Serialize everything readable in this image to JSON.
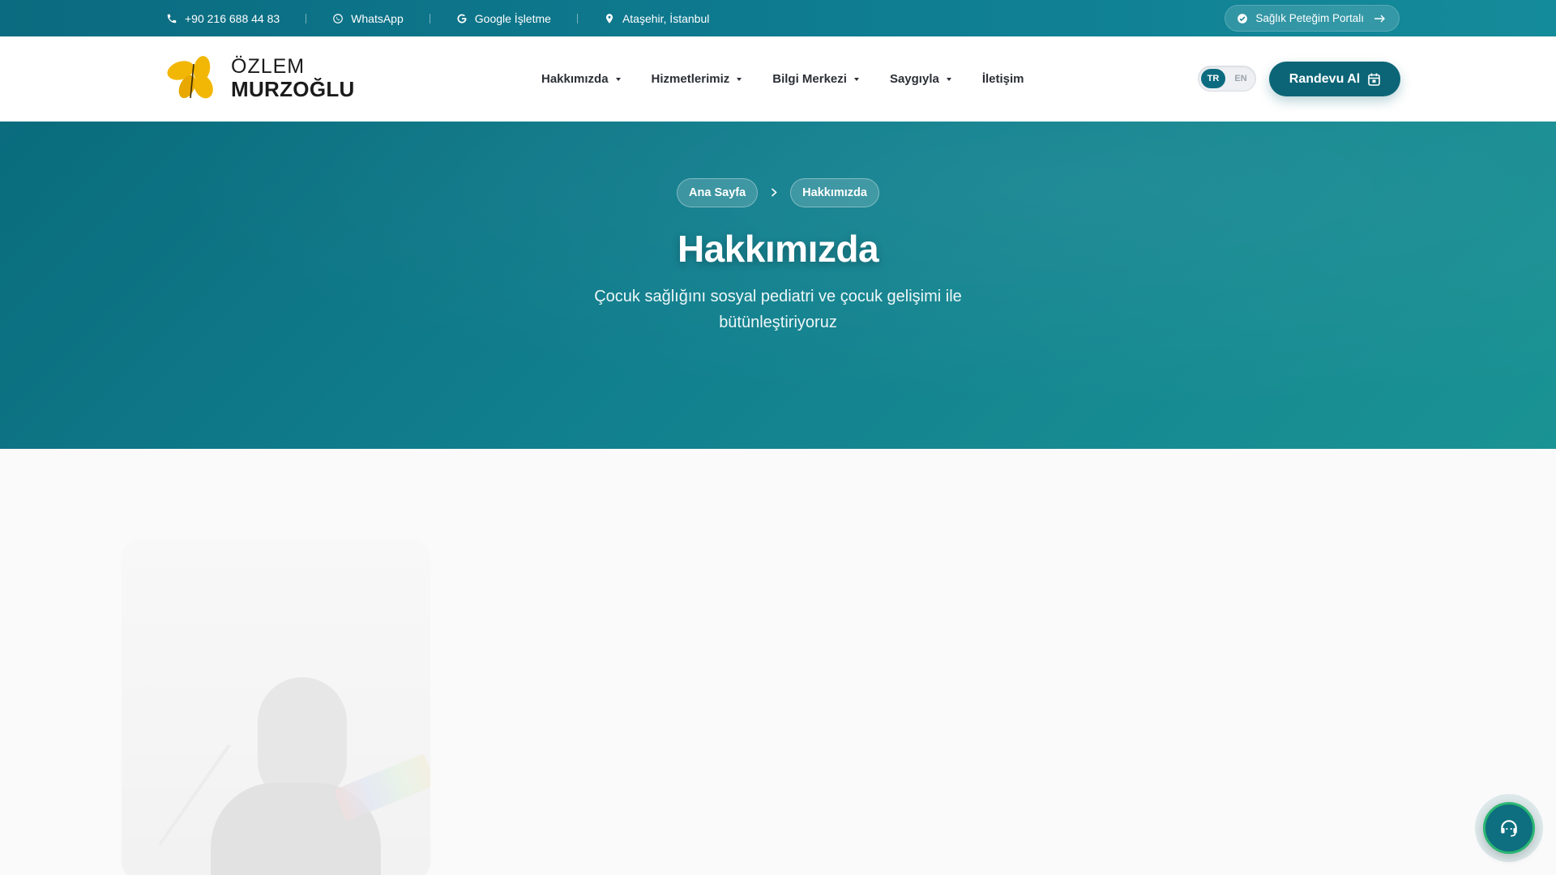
{
  "topbar": {
    "phone": "+90 216 688 44 83",
    "whatsapp": "WhatsApp",
    "google": "Google İşletme",
    "location": "Ataşehir, İstanbul",
    "portal": "Sağlık Peteğim Portalı"
  },
  "header": {
    "logo_line1": "ÖZLEM",
    "logo_line2": "MURZOĞLU",
    "nav": [
      {
        "label": "Hakkımızda",
        "dropdown": true
      },
      {
        "label": "Hizmetlerimiz",
        "dropdown": true
      },
      {
        "label": "Bilgi Merkezi",
        "dropdown": true
      },
      {
        "label": "Saygıyla",
        "dropdown": true
      },
      {
        "label": "İletişim",
        "dropdown": false
      }
    ],
    "lang": {
      "active": "TR",
      "inactive": "EN"
    },
    "cta": "Randevu Al"
  },
  "hero": {
    "breadcrumb": [
      "Ana Sayfa",
      "Hakkımızda"
    ],
    "title": "Hakkımızda",
    "subtitle": "Çocuk sağlığını sosyal pediatri ve çocuk gelişimi ile bütünleştiriyoruz"
  },
  "colors": {
    "brand_teal": "#0b6576",
    "hero_start": "#0a6c7d",
    "hero_end": "#1a9394",
    "logo_yellow": "#f2b705",
    "support_ring": "#2bb673"
  },
  "icons": {
    "phone": "phone-icon",
    "whatsapp": "whatsapp-icon",
    "google": "google-icon",
    "location": "location-pin-icon",
    "portal": "check-circle-icon",
    "portal_arrow": "arrow-right-icon",
    "cta": "calendar-icon",
    "support": "headset-icon"
  }
}
